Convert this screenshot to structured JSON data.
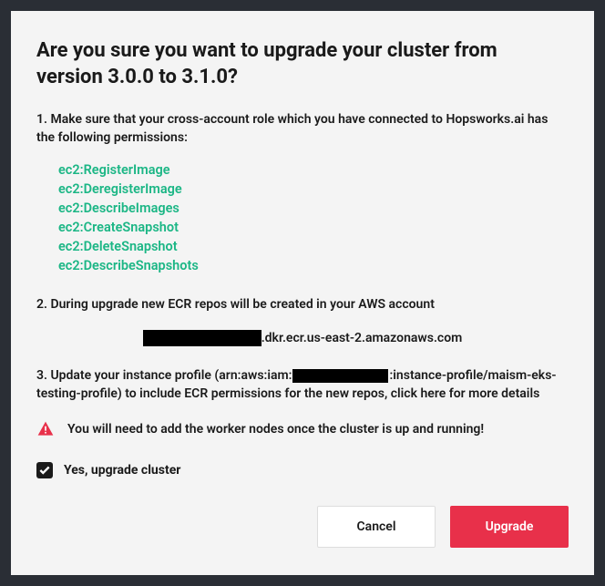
{
  "title": "Are you sure you want to upgrade your cluster from version 3.0.0 to 3.1.0?",
  "step1": "1. Make sure that your cross-account role which you have connected to Hopsworks.ai has the following permissions:",
  "permissions": [
    "ec2:RegisterImage",
    "ec2:DeregisterImage",
    "ec2:DescribeImages",
    "ec2:CreateSnapshot",
    "ec2:DeleteSnapshot",
    "ec2:DescribeSnapshots"
  ],
  "step2": "2. During upgrade new ECR repos will be created in your AWS account",
  "ecr_domain": ".dkr.ecr.us-east-2.amazonaws.com",
  "step3_prefix": "3. Update your instance profile (arn:aws:iam:",
  "step3_suffix": ":instance-profile/maism-eks-testing-profile) to include ECR permissions for the new repos, ",
  "step3_link": "click here for more details",
  "warning": "You will need to add the worker nodes once the cluster is up and running!",
  "checkbox_label": "Yes, upgrade cluster",
  "checkbox_checked": true,
  "buttons": {
    "cancel": "Cancel",
    "upgrade": "Upgrade"
  }
}
